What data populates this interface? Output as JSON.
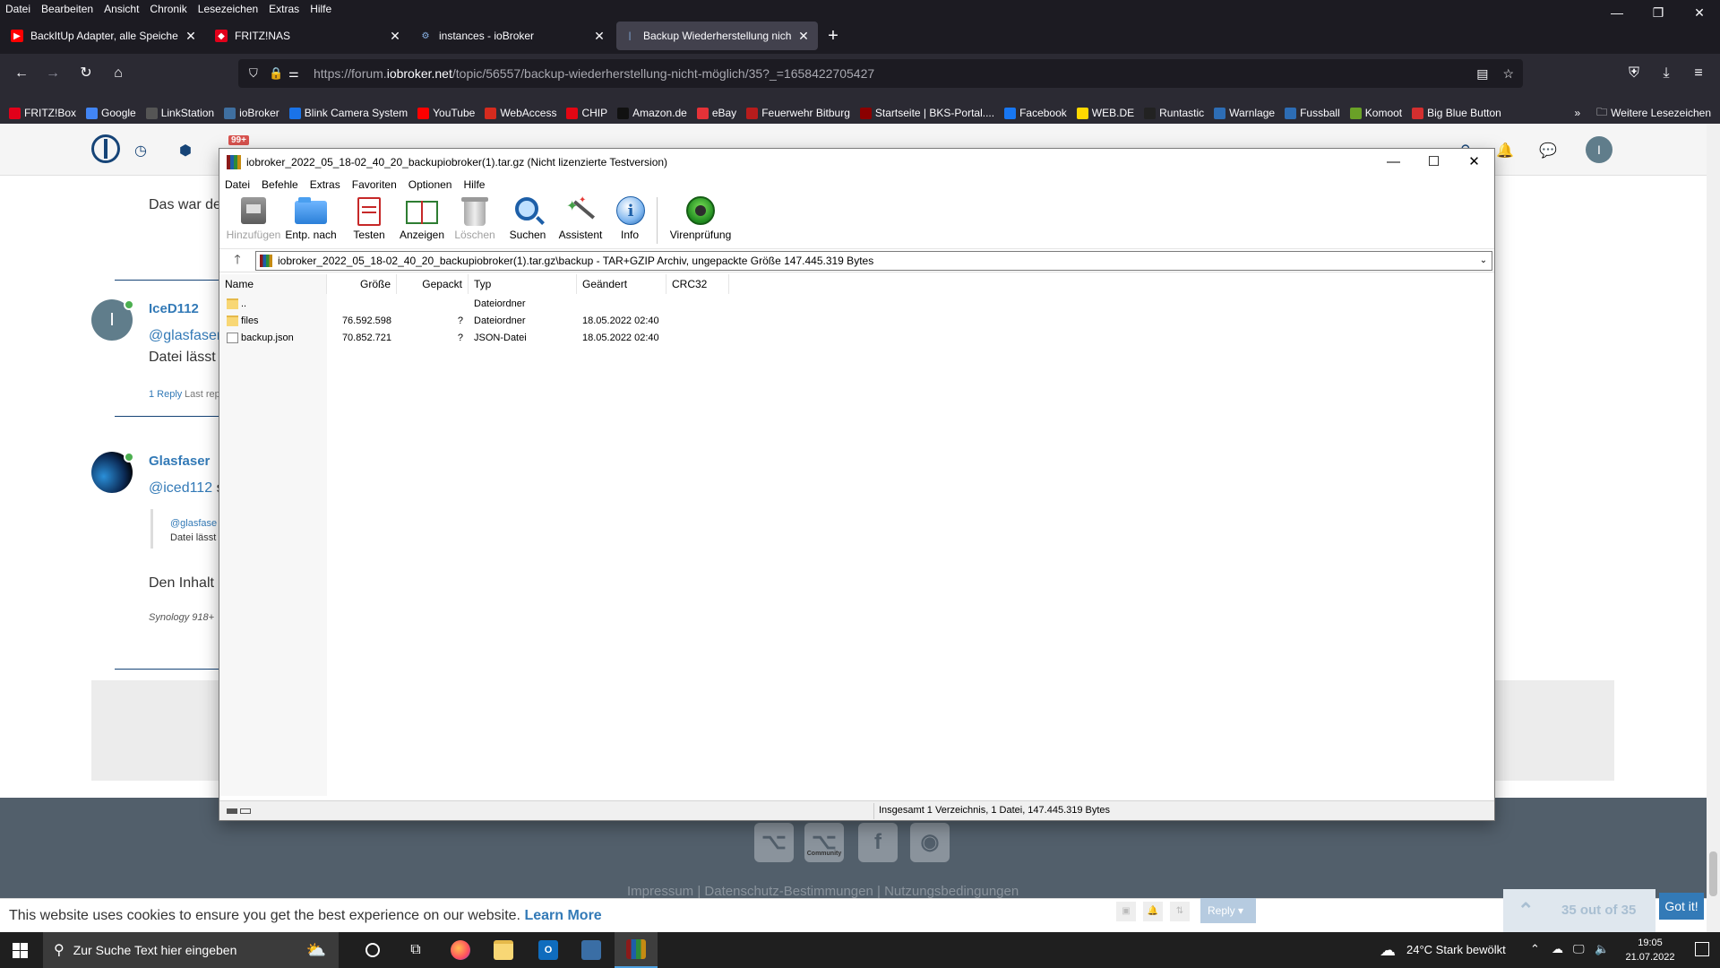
{
  "firefox": {
    "menubar": [
      "Datei",
      "Bearbeiten",
      "Ansicht",
      "Chronik",
      "Lesezeichen",
      "Extras",
      "Hilfe"
    ],
    "tabs": [
      {
        "title": "BackItUp Adapter, alle Speicher",
        "color": "#ff0000"
      },
      {
        "title": "FRITZ!NAS",
        "color": "#e2001a"
      },
      {
        "title": "instances - ioBroker",
        "color": "#3f6fa0"
      },
      {
        "title": "Backup Wiederherstellung nicht",
        "color": "#164477"
      }
    ],
    "url": {
      "prefix": "https://forum.",
      "domain": "iobroker.net",
      "rest": "/topic/56557/backup-wiederherstellung-nicht-möglich/35?_=1658422705427"
    },
    "bookmarks": [
      {
        "label": "FRITZ!Box",
        "color": "#e2001a"
      },
      {
        "label": "Google",
        "color": "#4285f4"
      },
      {
        "label": "LinkStation",
        "color": "#555555"
      },
      {
        "label": "ioBroker",
        "color": "#3f6fa0"
      },
      {
        "label": "Blink Camera System",
        "color": "#1a73e8"
      },
      {
        "label": "YouTube",
        "color": "#ff0000"
      },
      {
        "label": "WebAccess",
        "color": "#d52b1e"
      },
      {
        "label": "CHIP",
        "color": "#e30613"
      },
      {
        "label": "Amazon.de",
        "color": "#111111"
      },
      {
        "label": "eBay",
        "color": "#e53238"
      },
      {
        "label": "Feuerwehr Bitburg",
        "color": "#b71c1c"
      },
      {
        "label": "Startseite | BKS-Portal....",
        "color": "#8b0000"
      },
      {
        "label": "Facebook",
        "color": "#1877f2"
      },
      {
        "label": "WEB.DE",
        "color": "#ffd800"
      },
      {
        "label": "Runtastic",
        "color": "#222222"
      },
      {
        "label": "Warnlage",
        "color": "#2d6db5"
      },
      {
        "label": "Fussball",
        "color": "#2d6db5"
      },
      {
        "label": "Komoot",
        "color": "#6aa127"
      },
      {
        "label": "Big Blue Button",
        "color": "#d32f2f"
      }
    ],
    "more_bookmarks": "Weitere Lesezeichen"
  },
  "forum": {
    "notif_count": "99+",
    "nav_hint": "Hilfe",
    "user_initial": "I",
    "post0_text": "Das war de",
    "post1": {
      "author": "IceD112",
      "mention": "@glasfaser",
      "text": "Datei lässt",
      "reply_link": "1 Reply",
      "last_reply": "Last rep",
      "avatar_letter": "I"
    },
    "post2": {
      "author": "Glasfaser",
      "mention": "@iced112",
      "mention_suffix": "s",
      "quote_mention": "@glasfase",
      "quote_text": "Datei lässt",
      "text": "Den Inhalt",
      "signature": "Synology 918+"
    },
    "footer_links": "Impressum  |  Datenschutz-Bestimmungen  |  Nutzungsbedingungen",
    "footer_community": "Community",
    "cookie_text": "This website uses cookies to ensure you get the best experience on our website.",
    "cookie_link": "Learn More",
    "cookie_button": "Got it!",
    "pagination": "35 out of 35",
    "reply_button": "Reply"
  },
  "winrar": {
    "title": "iobroker_2022_05_18-02_40_20_backupiobroker(1).tar.gz (Nicht lizenzierte Testversion)",
    "menu": [
      "Datei",
      "Befehle",
      "Extras",
      "Favoriten",
      "Optionen",
      "Hilfe"
    ],
    "toolbar": [
      {
        "label": "Hinzufügen",
        "icon": "add-icon",
        "disabled": true
      },
      {
        "label": "Entp. nach",
        "icon": "extract-icon",
        "disabled": false
      },
      {
        "label": "Testen",
        "icon": "test-icon",
        "disabled": false
      },
      {
        "label": "Anzeigen",
        "icon": "view-icon",
        "disabled": false
      },
      {
        "label": "Löschen",
        "icon": "delete-icon",
        "disabled": true
      },
      {
        "label": "Suchen",
        "icon": "search-icon",
        "disabled": false
      },
      {
        "label": "Assistent",
        "icon": "wizard-icon",
        "disabled": false
      },
      {
        "label": "Info",
        "icon": "info-icon",
        "disabled": false
      },
      {
        "label": "Virenprüfung",
        "icon": "virus-scan-icon",
        "disabled": false
      }
    ],
    "path": "iobroker_2022_05_18-02_40_20_backupiobroker(1).tar.gz\\backup - TAR+GZIP Archiv, ungepackte Größe 147.445.319 Bytes",
    "columns": [
      "Name",
      "Größe",
      "Gepackt",
      "Typ",
      "Geändert",
      "CRC32"
    ],
    "rows": [
      {
        "name": "..",
        "size": "",
        "packed": "",
        "type": "Dateiordner",
        "modified": "",
        "crc": "",
        "kind": "folder"
      },
      {
        "name": "files",
        "size": "76.592.598",
        "packed": "?",
        "type": "Dateiordner",
        "modified": "18.05.2022 02:40",
        "crc": "",
        "kind": "folder"
      },
      {
        "name": "backup.json",
        "size": "70.852.721",
        "packed": "?",
        "type": "JSON-Datei",
        "modified": "18.05.2022 02:40",
        "crc": "",
        "kind": "file"
      }
    ],
    "status": "Insgesamt 1 Verzeichnis, 1 Datei, 147.445.319 Bytes"
  },
  "taskbar": {
    "search_placeholder": "Zur Suche Text hier eingeben",
    "weather": "24°C  Stark bewölkt",
    "time": "19:05",
    "date": "21.07.2022"
  }
}
